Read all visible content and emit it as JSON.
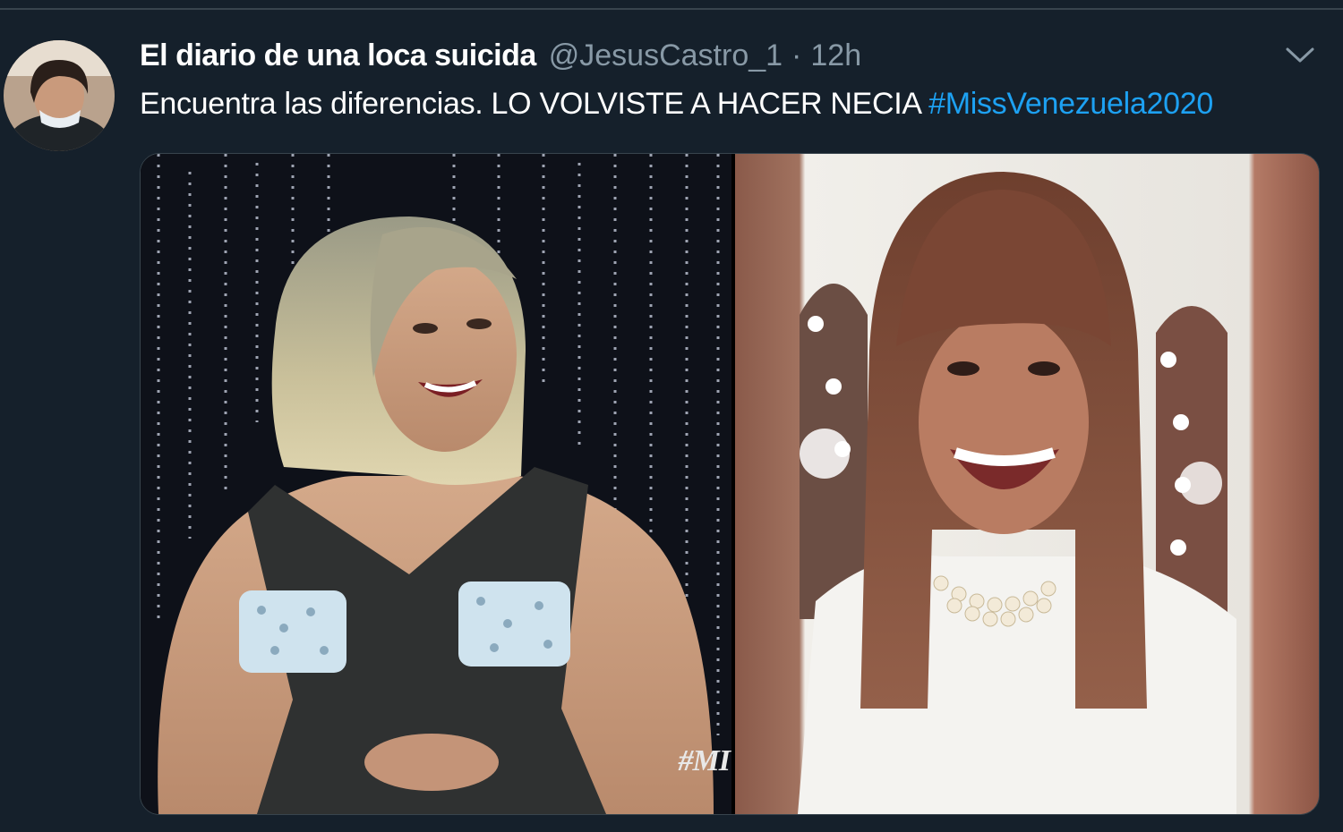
{
  "tweet": {
    "display_name": "El diario de una loca suicida",
    "handle": "@JesusCastro_1",
    "separator": "·",
    "timestamp": "12h",
    "text": "Encuentra las diferencias. LO VOLVISTE A HACER NECIA ",
    "hashtag": "#MissVenezuela2020",
    "menu_icon": "chevron-down-icon",
    "avatar_icon": "avatar",
    "media": {
      "left_photo_caption": "#MI",
      "right_photo": "photo"
    }
  },
  "colors": {
    "background": "#15202b",
    "text": "#ffffff",
    "secondary_text": "#8899a6",
    "link": "#1da1f2",
    "border": "#38444d"
  }
}
